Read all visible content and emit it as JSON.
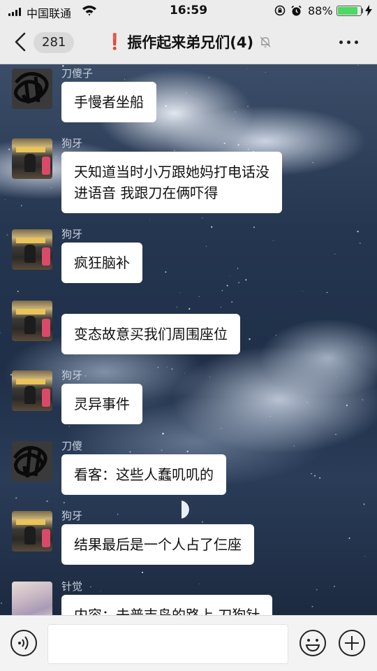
{
  "status_bar": {
    "carrier": "中国联通",
    "time": "16:59",
    "battery_pct": "88%",
    "battery_level": 0.88
  },
  "nav": {
    "unread_count": "281",
    "warn_mark": "❗",
    "title": "振作起来弟兄们(4)"
  },
  "messages": [
    {
      "sender": "刀傻子",
      "text": "手慢者坐船",
      "avatar": "scribble"
    },
    {
      "sender": "狗牙",
      "text": "天知道当时小万跟她妈打电话没\n进语音 我跟刀在俩吓得",
      "avatar": "photo"
    },
    {
      "sender": "狗牙",
      "text": "疯狂脑补",
      "avatar": "photo"
    },
    {
      "sender": "",
      "text": "变态故意买我们周围座位",
      "avatar": "photo"
    },
    {
      "sender": "狗牙",
      "text": "灵异事件",
      "avatar": "photo"
    },
    {
      "sender": "刀傻",
      "text": "看客：这些人蠢叽叽的",
      "avatar": "scribble"
    },
    {
      "sender": "狗牙",
      "text": "结果最后是一个人占了仨座",
      "avatar": "photo"
    },
    {
      "sender": "针觉",
      "text": "内容：去普吉岛的路上 刀狗针",
      "avatar": "light"
    }
  ],
  "input": {
    "placeholder": ""
  }
}
